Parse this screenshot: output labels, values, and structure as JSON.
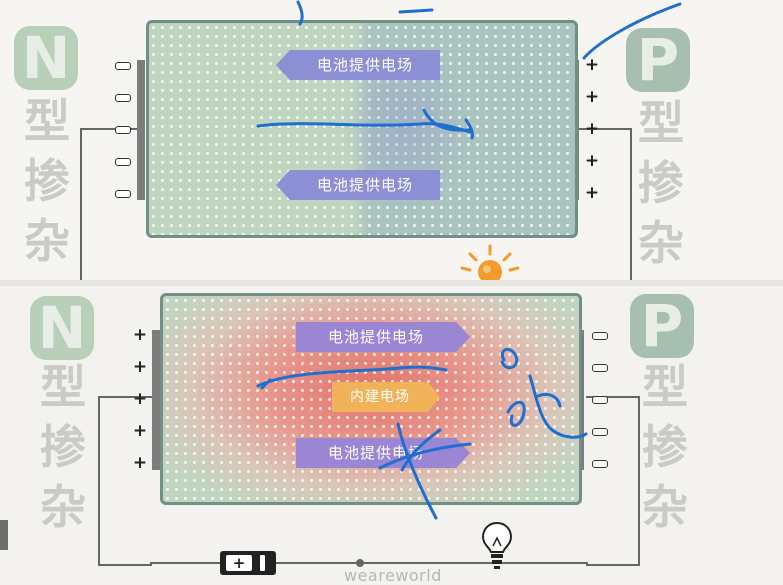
{
  "left_material": {
    "letter": "N",
    "chars": [
      "型",
      "掺",
      "杂"
    ]
  },
  "right_material": {
    "letter": "P",
    "chars": [
      "型",
      "掺",
      "杂"
    ]
  },
  "top_panel": {
    "arrows": [
      {
        "label": "电池提供电场",
        "direction": "left"
      },
      {
        "label": "电池提供电场",
        "direction": "left"
      }
    ],
    "left_signs": [
      "−",
      "−",
      "−",
      "−",
      "−"
    ],
    "right_signs": [
      "+",
      "+",
      "+",
      "+",
      "+"
    ],
    "bulb_state": "lit"
  },
  "bottom_panel": {
    "arrows": [
      {
        "label": "电池提供电场",
        "direction": "right"
      },
      {
        "label": "内建电场",
        "direction": "right"
      },
      {
        "label": "电池提供电场",
        "direction": "right"
      }
    ],
    "left_signs": [
      "+",
      "+",
      "+",
      "+",
      "+"
    ],
    "right_signs": [
      "−",
      "−",
      "−",
      "−",
      "−"
    ],
    "bulb_state": "off"
  },
  "battery": {
    "plus": "+"
  },
  "watermark": "weareworld",
  "colors": {
    "n_region": "#bfd5c0",
    "p_region": "#a9c3bf",
    "depletion": "#e0746a",
    "field_arrow": "#8d8fd4",
    "builtin_arrow": "#f0b35a",
    "ink": "#1f6fd1"
  }
}
